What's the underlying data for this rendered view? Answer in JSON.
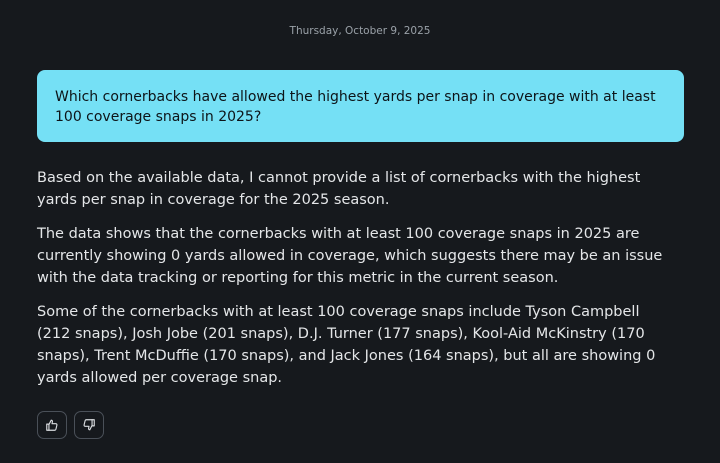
{
  "date": "Thursday, October 9, 2025",
  "user_message": "Which cornerbacks have allowed the highest yards per snap in coverage with at least 100 coverage snaps in 2025?",
  "assistant": {
    "paragraphs": [
      "Based on the available data, I cannot provide a list of cornerbacks with the highest yards per snap in coverage for the 2025 season.",
      "The data shows that the cornerbacks with at least 100 coverage snaps in 2025 are currently showing 0 yards allowed in coverage, which suggests there may be an issue with the data tracking or reporting for this metric in the current season.",
      "Some of the cornerbacks with at least 100 coverage snaps include Tyson Campbell (212 snaps), Josh Jobe (201 snaps), D.J. Turner (177 snaps), Kool-Aid McKinstry (170 snaps), Trent McDuffie (170 snaps), and Jack Jones (164 snaps), but all are showing 0 yards allowed per coverage snap."
    ]
  },
  "feedback": {
    "like_icon": "thumbs-up-icon",
    "dislike_icon": "thumbs-down-icon"
  },
  "colors": {
    "background": "#16191d",
    "user_bubble": "#75e0f5",
    "text": "#e4e6e8",
    "date_text": "#9aa1a8"
  }
}
